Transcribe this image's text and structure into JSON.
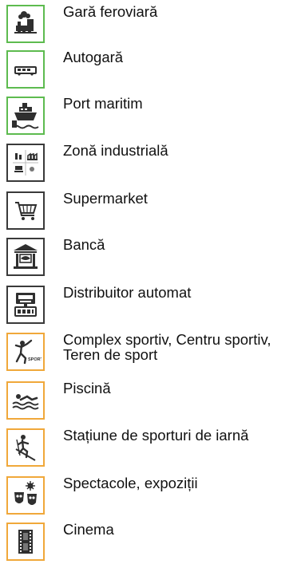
{
  "colors": {
    "transport": "#5dbb4f",
    "services": "#3a3a3a",
    "leisure": "#f0a83a",
    "glyph": "#2f2f2f"
  },
  "legend": [
    {
      "category": "transport",
      "icon": "train-icon",
      "label": "Gară feroviară"
    },
    {
      "category": "transport",
      "icon": "bus-icon",
      "label": "Autogară"
    },
    {
      "category": "transport",
      "icon": "ship-icon",
      "label": "Port maritim"
    },
    {
      "category": "services",
      "icon": "industry-icon",
      "label": "Zonă industrială"
    },
    {
      "category": "services",
      "icon": "shopping-cart-icon",
      "label": "Supermarket"
    },
    {
      "category": "services",
      "icon": "bank-icon",
      "label": "Bancă"
    },
    {
      "category": "services",
      "icon": "atm-icon",
      "label": "Distribuitor automat"
    },
    {
      "category": "leisure",
      "icon": "sport-icon",
      "label": "Complex sportiv, Centru sportiv,\nTeren de sport"
    },
    {
      "category": "leisure",
      "icon": "swimming-icon",
      "label": "Piscină"
    },
    {
      "category": "leisure",
      "icon": "skiing-icon",
      "label": "Stațiune de sporturi de iarnă"
    },
    {
      "category": "leisure",
      "icon": "theatre-masks-icon",
      "label": "Spectacole, expoziții"
    },
    {
      "category": "leisure",
      "icon": "cinema-film-icon",
      "label": "Cinema"
    }
  ]
}
